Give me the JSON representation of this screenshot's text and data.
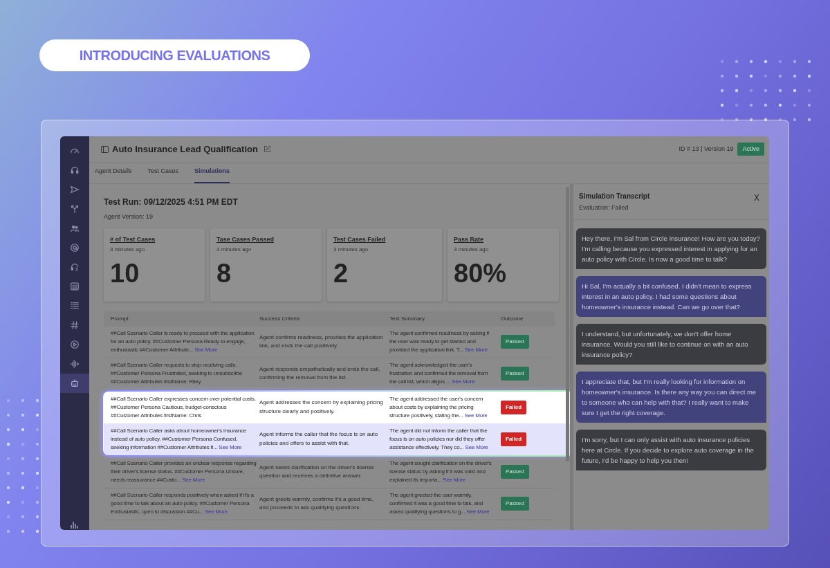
{
  "banner": {
    "label": "INTRODUCING EVALUATIONS"
  },
  "sidebar": {
    "items": [
      {
        "selected": false
      },
      {
        "selected": false
      },
      {
        "selected": false
      },
      {
        "selected": false
      },
      {
        "selected": false
      },
      {
        "selected": false
      },
      {
        "selected": false
      },
      {
        "selected": false
      },
      {
        "selected": false
      },
      {
        "selected": false
      },
      {
        "selected": false
      },
      {
        "selected": false
      },
      {
        "selected": true
      }
    ]
  },
  "header": {
    "title": "Auto Insurance Lead Qualification",
    "meta": "ID # 13 | Version 19",
    "status": "Active"
  },
  "tabs": [
    {
      "label": "Agent Details",
      "selected": false
    },
    {
      "label": "Test Cases",
      "selected": false
    },
    {
      "label": "Simulations",
      "selected": true
    }
  ],
  "run": {
    "title": "Test Run: 09/12/2025 4:51 PM EDT",
    "version": "Agent Version: 19"
  },
  "stats": [
    {
      "title": "# of Test Cases",
      "time": "3 minutes ago",
      "value": "10"
    },
    {
      "title": "Tase Cases Passed",
      "time": "3 minutes ago",
      "value": "8"
    },
    {
      "title": "Test Cases Failed",
      "time": "3 minutes ago",
      "value": "2"
    },
    {
      "title": "Pass Rate",
      "time": "3 minutes ago",
      "value": "80%"
    }
  ],
  "table": {
    "columns": [
      "Prompt",
      "Success Criteria",
      "Test Summary",
      "Outcome"
    ],
    "rows": [
      {
        "prompt": "##Call Scenario Caller is ready to proceed with the application for an auto policy. ##Customer Persona Ready to engage, enthusiastic ##Customer Attribute...",
        "prompt_link": "See More",
        "criteria": "Agent confirms readiness, provides the application link, and ends the call positively.",
        "summary": "The agent confirmed readiness by asking if the user was ready to get started and provided the application link. T...",
        "summary_link": "See More",
        "outcome": {
          "text": "Passed",
          "kind": "passed"
        },
        "highlighted": false,
        "selected": false
      },
      {
        "prompt": "##Call Scenario Caller requests to stop receiving calls. ##Customer Persona Frustrated, seeking to unsubscribe ##Customer Attributes firstName: Riley",
        "criteria": "Agent responds empathetically and ends the call, confirming the removal from the list.",
        "summary": "The agent acknowledged the user's frustration and confirmed the removal from the call list, which aligns ...",
        "summary_link": "See More",
        "outcome": {
          "text": "Passed",
          "kind": "passed"
        },
        "highlighted": false,
        "selected": false
      },
      {
        "prompt": "##Call Scenario Caller expresses concern over potential costs. ##Customer Persona Cautious, budget-conscious ##Customer Attributes firstName: Chris",
        "criteria": "Agent addresses the concern by explaining pricing structure clearly and positively.",
        "summary": "The agent addressed the user's concern about costs by explaining the pricing structure positively, stating the...",
        "summary_link": "See More",
        "outcome": {
          "text": "Failed",
          "kind": "failed"
        },
        "highlighted": true,
        "selected": false
      },
      {
        "prompt": "##Call Scenario Caller asks about homeowner's insurance instead of auto policy. ##Customer Persona Confused, seeking information ##Customer Attributes fi...",
        "prompt_link": "See More",
        "criteria": "Agent informs the caller that the focus is on auto policies and offers to assist with that.",
        "summary": "The agent did not inform the caller that the focus is on auto policies nor did they offer assistance effectively. They co...",
        "summary_link": "See More",
        "outcome": {
          "text": "Failed",
          "kind": "failed"
        },
        "highlighted": true,
        "selected": true
      },
      {
        "prompt": "##Call Scenario Caller provides an unclear response regarding their driver's license status. ##Customer Persona Unsure, needs reassurance ##Custo...",
        "prompt_link": "See More",
        "criteria": "Agent seeks clarification on the driver's license question and receives a definitive answer.",
        "summary": "The agent sought clarification on the driver's license status by asking if it was valid and explained its importa...",
        "summary_link": "See More",
        "outcome": {
          "text": "Passed",
          "kind": "passed"
        },
        "highlighted": false,
        "selected": false
      },
      {
        "prompt": "##Call Scenario Caller responds positively when asked if it's a good time to talk about an auto policy. ##Customer Persona Enthusiastic, open to discussion ##Cu...",
        "prompt_link": "See More",
        "criteria": "Agent greets warmly, confirms it's a good time, and proceeds to ask qualifying questions.",
        "summary": "The agent greeted the user warmly, confirmed it was a good time to talk, and asked qualifying questions to g...",
        "summary_link": "See More",
        "outcome": {
          "text": "Passed",
          "kind": "passed"
        },
        "highlighted": false,
        "selected": false
      }
    ]
  },
  "transcript": {
    "title": "Simulation Transcript",
    "evaluation": "Evaluation: Failed",
    "close": "X",
    "messages": [
      {
        "kind": "agent",
        "text": "Hey there, I'm Sal from Circle Insurance! How are you today? I'm calling because you expressed interest in applying for an auto policy with Circle. Is now a good time to talk?"
      },
      {
        "kind": "caller",
        "text": "Hi Sal, I'm actually a bit confused. I didn't mean to express interest in an auto policy. I had some questions about homeowner's insurance instead. Can we go over that?"
      },
      {
        "kind": "agent",
        "text": "I understand, but unfortunately, we don't offer home insurance. Would you still like to continue on with an auto insurance policy?"
      },
      {
        "kind": "caller",
        "text": "I appreciate that, but I'm really looking for information on homeowner's insurance. Is there any way you can direct me to someone who can help with that? I really want to make sure I get the right coverage."
      },
      {
        "kind": "agent",
        "text": "I'm sorry, but I can only assist with auto insurance policies here at Circle. If you decide to explore auto coverage in the future, I'd be happy to help you then!"
      }
    ]
  }
}
